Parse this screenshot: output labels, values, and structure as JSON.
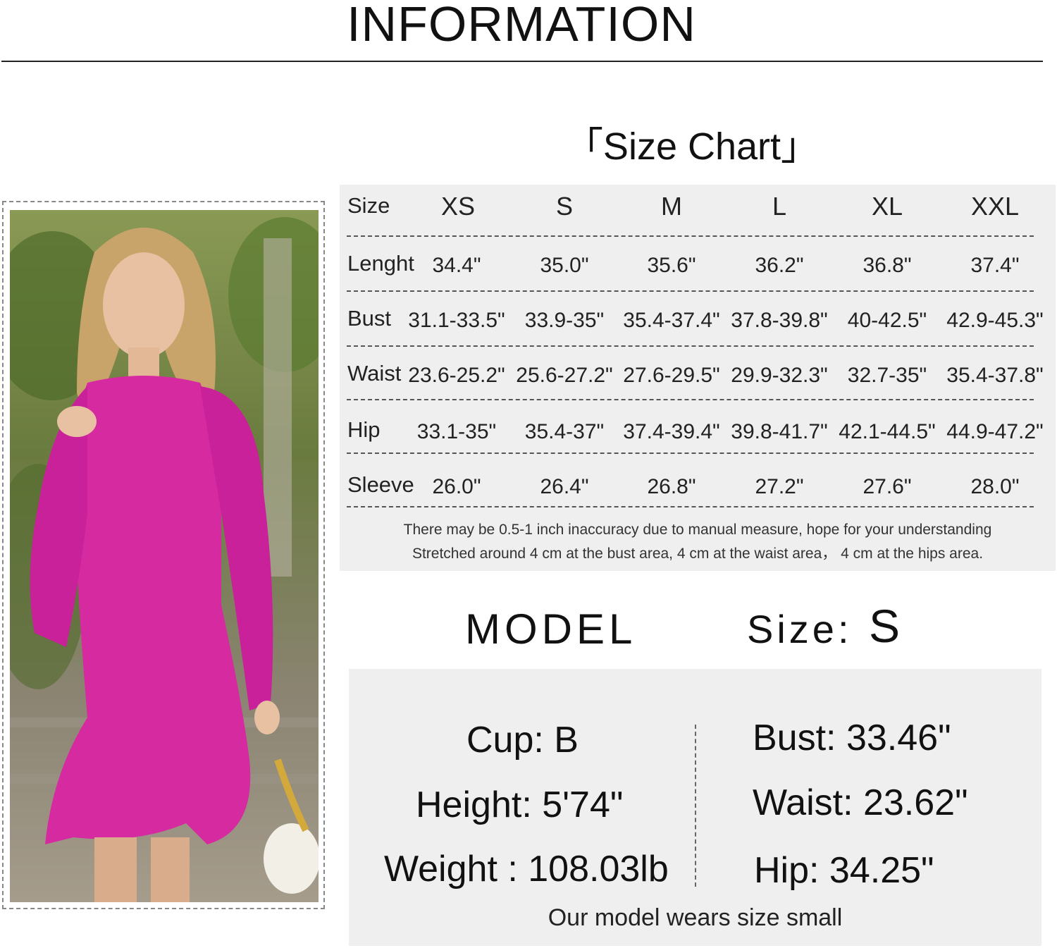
{
  "header": {
    "title": "INFORMATION"
  },
  "size_chart": {
    "title": "「Size Chart」",
    "header_label": "Size",
    "sizes": [
      "XS",
      "S",
      "M",
      "L",
      "XL",
      "XXL"
    ],
    "rows": [
      {
        "label": "Lenght",
        "values": [
          "34.4\"",
          "35.0\"",
          "35.6\"",
          "36.2\"",
          "36.8\"",
          "37.4\""
        ]
      },
      {
        "label": "Bust",
        "values": [
          "31.1-33.5\"",
          "33.9-35\"",
          "35.4-37.4\"",
          "37.8-39.8\"",
          "40-42.5\"",
          "42.9-45.3\""
        ]
      },
      {
        "label": "Waist",
        "values": [
          "23.6-25.2\"",
          "25.6-27.2\"",
          "27.6-29.5\"",
          "29.9-32.3\"",
          "32.7-35\"",
          "35.4-37.8\""
        ]
      },
      {
        "label": "Hip",
        "values": [
          "33.1-35\"",
          "35.4-37\"",
          "37.4-39.4\"",
          "39.8-41.7\"",
          "42.1-44.5\"",
          "44.9-47.2\""
        ]
      },
      {
        "label": "Sleeve",
        "values": [
          "26.0\"",
          "26.4\"",
          "26.8\"",
          "27.2\"",
          "27.6\"",
          "28.0\""
        ]
      }
    ],
    "note_1": "There may be 0.5-1 inch inaccuracy due to manual measure, hope for your understanding",
    "note_2": "Stretched around 4 cm at the bust area, 4 cm at the waist area， 4 cm at the hips area."
  },
  "model": {
    "label": "MODEL",
    "size_label": "Size:",
    "size_value": "S",
    "cup": "Cup: B",
    "height": "Height: 5'74\"",
    "weight": "Weight : 108.03lb",
    "bust": "Bust: 33.46\"",
    "waist": "Waist: 23.62\"",
    "hip": "Hip: 34.25\"",
    "note": "Our model wears size small"
  },
  "colors": {
    "dress": "#d62aa0",
    "panel_bg": "#efefef",
    "text": "#111111"
  }
}
